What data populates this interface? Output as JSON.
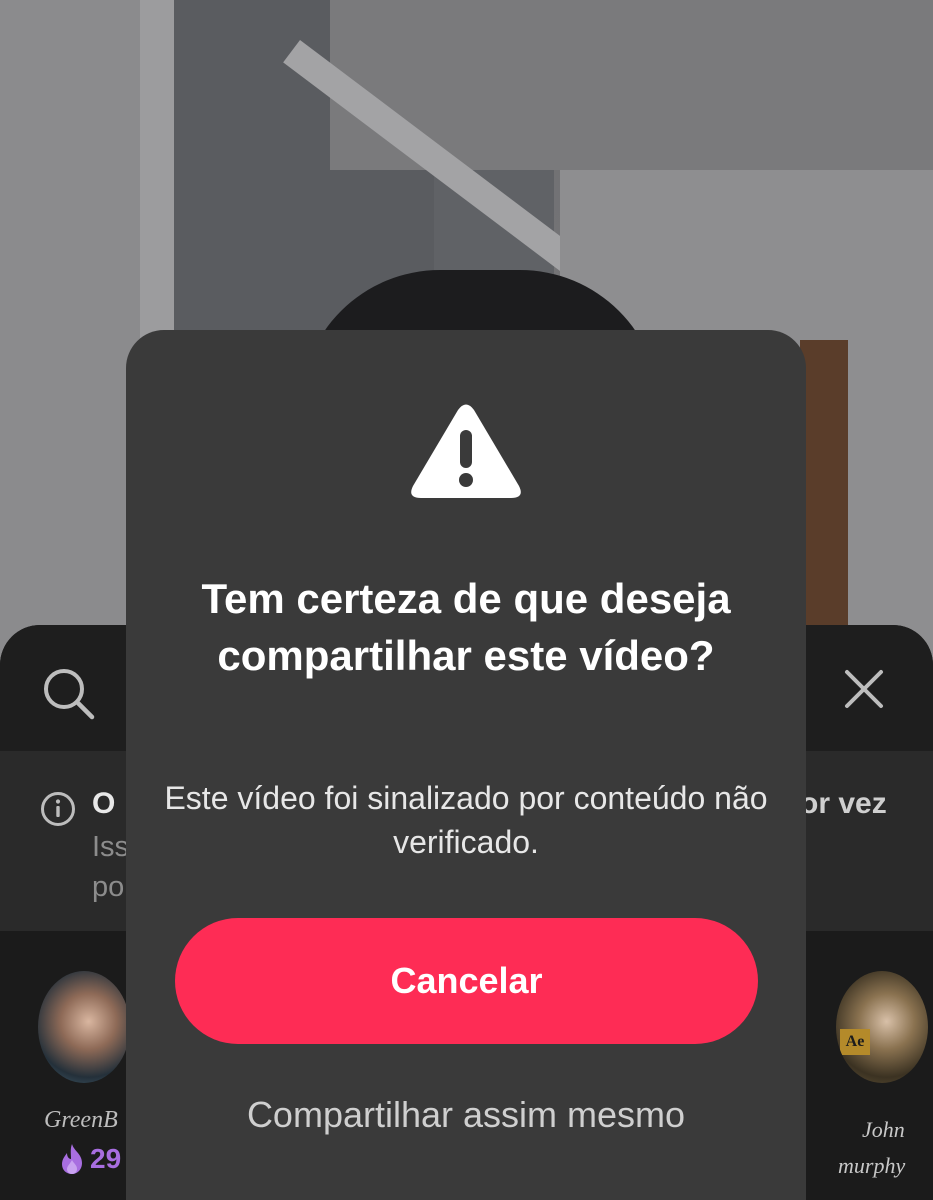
{
  "share_sheet": {
    "search_icon": "search-icon",
    "close_icon": "close-icon",
    "notice": {
      "icon": "info-icon",
      "title_visible_left": "O",
      "title_visible_right": "or vez",
      "line2_visible": "Iss",
      "line3_visible": "po"
    },
    "contacts": [
      {
        "name_visible": "GreenB",
        "streak_icon": "flame-icon",
        "streak_visible": "29"
      },
      {
        "name_line1": "John",
        "name_line2": "murphy",
        "badge": "Ae"
      }
    ]
  },
  "modal": {
    "icon": "warning-icon",
    "title": "Tem certeza de que deseja compartilhar este vídeo?",
    "message": "Este vídeo foi sinalizado por conteúdo não verificado.",
    "cancel_label": "Cancelar",
    "share_anyway_label": "Compartilhar assim mesmo"
  },
  "colors": {
    "primary_button": "#fe2c55",
    "modal_background": "#3a3a3a",
    "streak": "#a86ee0"
  }
}
